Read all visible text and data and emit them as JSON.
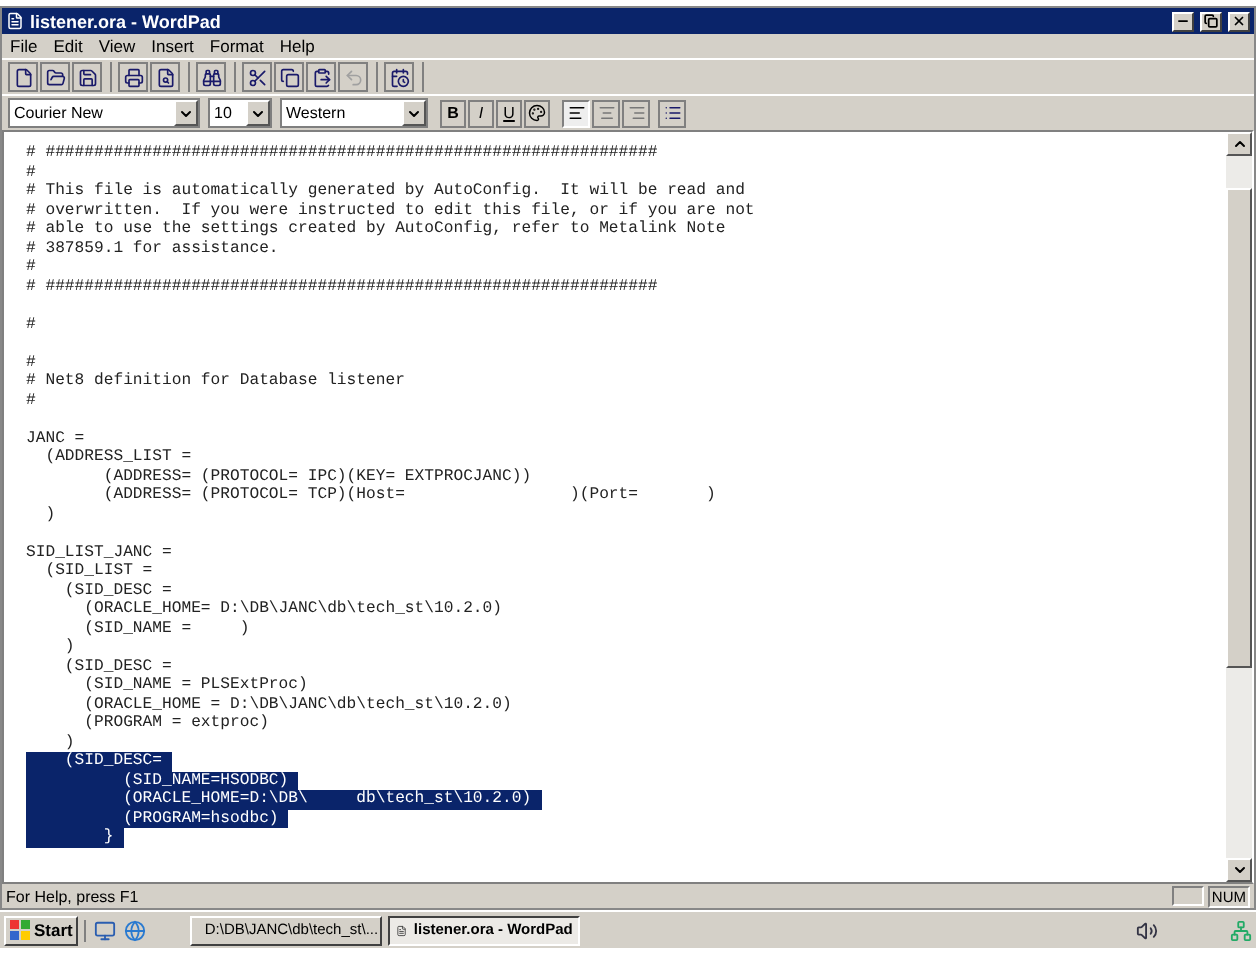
{
  "window": {
    "title": "listener.ora - WordPad"
  },
  "menu": [
    "File",
    "Edit",
    "View",
    "Insert",
    "Format",
    "Help"
  ],
  "toolbar": {
    "groups": [
      [
        {
          "disabled": false
        },
        {
          "disabled": false
        },
        {
          "disabled": false
        }
      ],
      [
        {
          "disabled": false
        },
        {
          "disabled": false
        }
      ],
      [
        {
          "disabled": false
        }
      ],
      [
        {
          "disabled": false
        },
        {
          "disabled": false
        },
        {
          "disabled": false
        },
        {
          "disabled": true
        }
      ],
      [
        {
          "disabled": false
        }
      ]
    ]
  },
  "format_bar": {
    "font": "Courier New",
    "size": "10",
    "script": "Western",
    "styles": [
      "B",
      "I",
      "U"
    ],
    "alignment": [
      {
        "selected": true
      },
      {
        "selected": false
      },
      {
        "selected": false
      }
    ]
  },
  "document": {
    "lines": [
      {
        "kind": "text",
        "text": "# ###############################################################"
      },
      {
        "kind": "text",
        "text": "#"
      },
      {
        "kind": "text",
        "text": "# This file is automatically generated by AutoConfig.  It will be read and"
      },
      {
        "kind": "text",
        "text": "# overwritten.  If you were instructed to edit this file, or if you are not"
      },
      {
        "kind": "text",
        "text": "# able to use the settings created by AutoConfig, refer to Metalink Note"
      },
      {
        "kind": "text",
        "text": "# 387859.1 for assistance."
      },
      {
        "kind": "text",
        "text": "#"
      },
      {
        "kind": "text",
        "text": "# ###############################################################"
      },
      {
        "kind": "blank"
      },
      {
        "kind": "text",
        "text": "#"
      },
      {
        "kind": "blank"
      },
      {
        "kind": "text",
        "text": "#"
      },
      {
        "kind": "text",
        "text": "# Net8 definition for Database listener"
      },
      {
        "kind": "text",
        "text": "#"
      },
      {
        "kind": "blank"
      },
      {
        "kind": "text",
        "text": "JANC ="
      },
      {
        "kind": "text",
        "text": "  (ADDRESS_LIST ="
      },
      {
        "kind": "text",
        "text": "        (ADDRESS= (PROTOCOL= IPC)(KEY= EXTPROCJANC))"
      },
      {
        "kind": "text",
        "text": "        (ADDRESS= (PROTOCOL= TCP)(Host=                 )(Port=       )"
      },
      {
        "kind": "text",
        "text": "  )"
      },
      {
        "kind": "blank"
      },
      {
        "kind": "text",
        "text": "SID_LIST_JANC ="
      },
      {
        "kind": "text",
        "text": "  (SID_LIST ="
      },
      {
        "kind": "text",
        "text": "    (SID_DESC ="
      },
      {
        "kind": "text",
        "text": "      (ORACLE_HOME= D:\\DB\\JANC\\db\\tech_st\\10.2.0)"
      },
      {
        "kind": "text",
        "text": "      (SID_NAME =     )"
      },
      {
        "kind": "text",
        "text": "    )"
      },
      {
        "kind": "text",
        "text": "    (SID_DESC ="
      },
      {
        "kind": "text",
        "text": "      (SID_NAME = PLSExtProc)"
      },
      {
        "kind": "text",
        "text": "      (ORACLE_HOME = D:\\DB\\JANC\\db\\tech_st\\10.2.0)"
      },
      {
        "kind": "text",
        "text": "      (PROGRAM = extproc)"
      },
      {
        "kind": "text",
        "text": "    )"
      }
    ],
    "selection": [
      "    (SID_DESC=",
      "          (SID_NAME=HSODBC)",
      "          (ORACLE_HOME=D:\\DB\\     db\\tech_st\\10.2.0)",
      "          (PROGRAM=hsodbc)",
      "        }"
    ]
  },
  "status_bar": {
    "help": "For Help, press F1",
    "num": "NUM"
  },
  "taskbar": {
    "start": "Start",
    "tasks": [
      {
        "label": "D:\\DB\\JANC\\db\\tech_st\\...",
        "selected": false
      },
      {
        "label": "listener.ora - WordPad",
        "selected": true
      }
    ]
  }
}
